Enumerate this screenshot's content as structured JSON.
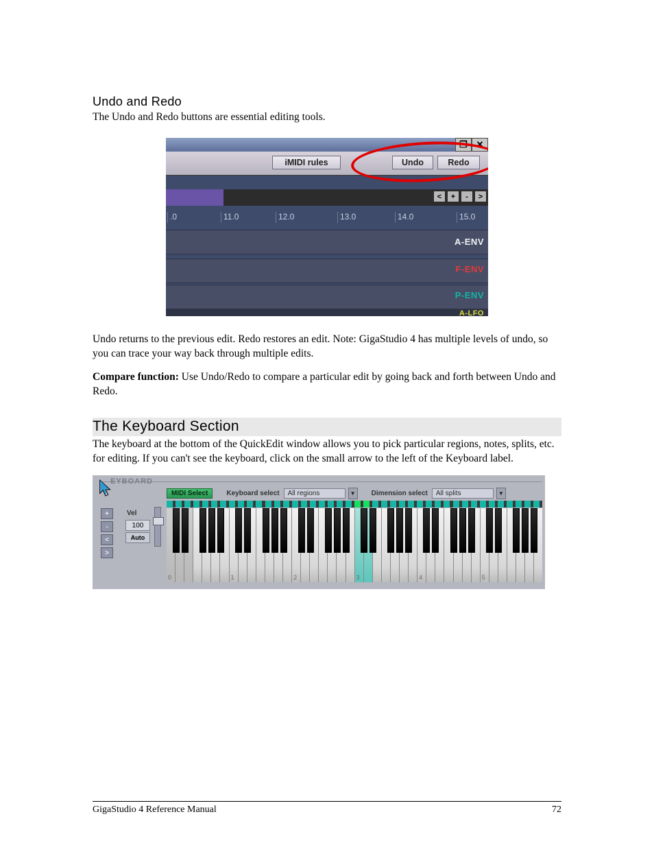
{
  "section1": {
    "heading": "Undo and Redo",
    "p1": "The Undo and Redo buttons are essential editing tools.",
    "p2": "Undo returns to the previous edit. Redo restores an edit. Note: GigaStudio 4 has multiple levels of undo, so you can trace your way back through multiple edits.",
    "compare_label": "Compare function:",
    "compare_text": " Use Undo/Redo to compare a particular edit by going back and forth between Undo and Redo."
  },
  "fig1": {
    "imidi": "iMIDI rules",
    "undo": "Undo",
    "redo": "Redo",
    "win_restore": "❐",
    "win_close": "✕",
    "nav": {
      "back": "<",
      "plus": "+",
      "minus": "-",
      "fwd": ">"
    },
    "ticks": [
      ".0",
      "11.0",
      "12.0",
      "13.0",
      "14.0",
      "15.0"
    ],
    "env": [
      "A-ENV",
      "F-ENV",
      "P-ENV",
      "A-LFO"
    ]
  },
  "section2": {
    "heading": "The Keyboard Section",
    "p1": "The keyboard at the bottom of the QuickEdit window allows you to pick particular regions, notes, splits, etc. for editing. If you can't see the keyboard, click on the small arrow to the left of the Keyboard label."
  },
  "fig2": {
    "panel_label": "EYBOARD",
    "midi_select": "MIDI Select",
    "keyboard_select": "Keyboard select",
    "all_regions": "All regions",
    "dimension_select": "Dimension select",
    "all_splits": "All splits",
    "vel_label": "Vel",
    "vel_value": "100",
    "auto": "Auto",
    "side_buttons": [
      "+",
      "-",
      "<",
      ">"
    ],
    "octave_labels": [
      "0",
      "1",
      "2",
      "3",
      "4",
      "5"
    ]
  },
  "footer": {
    "left": "GigaStudio 4 Reference Manual",
    "right": "72"
  }
}
